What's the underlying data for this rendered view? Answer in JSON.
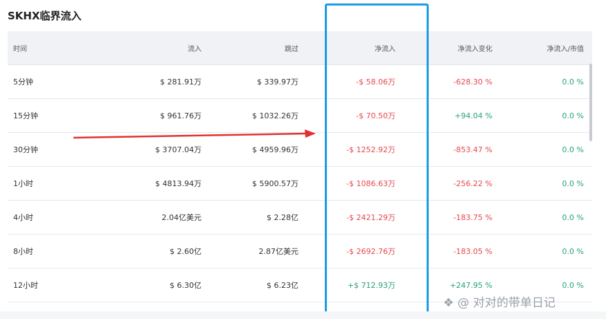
{
  "title": "SKHX临界流入",
  "columns": [
    "时间",
    "流入",
    "跳过",
    "净流入",
    "净流入变化",
    "净流入/市值"
  ],
  "rows": [
    {
      "time": "5分钟",
      "inflow": "$ 281.91万",
      "skip": "$ 339.97万",
      "net": "-$ 58.06万",
      "change": "-628.30 %",
      "ratio": "0.0 %",
      "net_dir": "neg",
      "change_dir": "neg"
    },
    {
      "time": "15分钟",
      "inflow": "$ 961.76万",
      "skip": "$ 1032.26万",
      "net": "-$ 70.50万",
      "change": "+94.04 %",
      "ratio": "0.0 %",
      "net_dir": "neg",
      "change_dir": "pos"
    },
    {
      "time": "30分钟",
      "inflow": "$ 3707.04万",
      "skip": "$ 4959.96万",
      "net": "-$ 1252.92万",
      "change": "-853.47 %",
      "ratio": "0.0 %",
      "net_dir": "neg",
      "change_dir": "neg"
    },
    {
      "time": "1小时",
      "inflow": "$ 4813.94万",
      "skip": "$ 5900.57万",
      "net": "-$ 1086.63万",
      "change": "-256.22 %",
      "ratio": "0.0 %",
      "net_dir": "neg",
      "change_dir": "neg"
    },
    {
      "time": "4小时",
      "inflow": "2.04亿美元",
      "skip": "$ 2.28亿",
      "net": "-$ 2421.29万",
      "change": "-183.75 %",
      "ratio": "0.0 %",
      "net_dir": "neg",
      "change_dir": "neg"
    },
    {
      "time": "8小时",
      "inflow": "$ 2.60亿",
      "skip": "2.87亿美元",
      "net": "-$ 2692.76万",
      "change": "-183.05 %",
      "ratio": "0.0 %",
      "net_dir": "neg",
      "change_dir": "neg"
    },
    {
      "time": "12小时",
      "inflow": "$ 6.30亿",
      "skip": "$ 6.23亿",
      "net": "+$ 712.93万",
      "change": "+247.95 %",
      "ratio": "0.0 %",
      "net_dir": "pos",
      "change_dir": "pos"
    }
  ],
  "watermark": "❖ @ 对对的带单日记",
  "colors": {
    "negative": "#e5484d",
    "positive": "#27a27a",
    "highlight": "#1a9be8",
    "arrow": "#e03131"
  }
}
